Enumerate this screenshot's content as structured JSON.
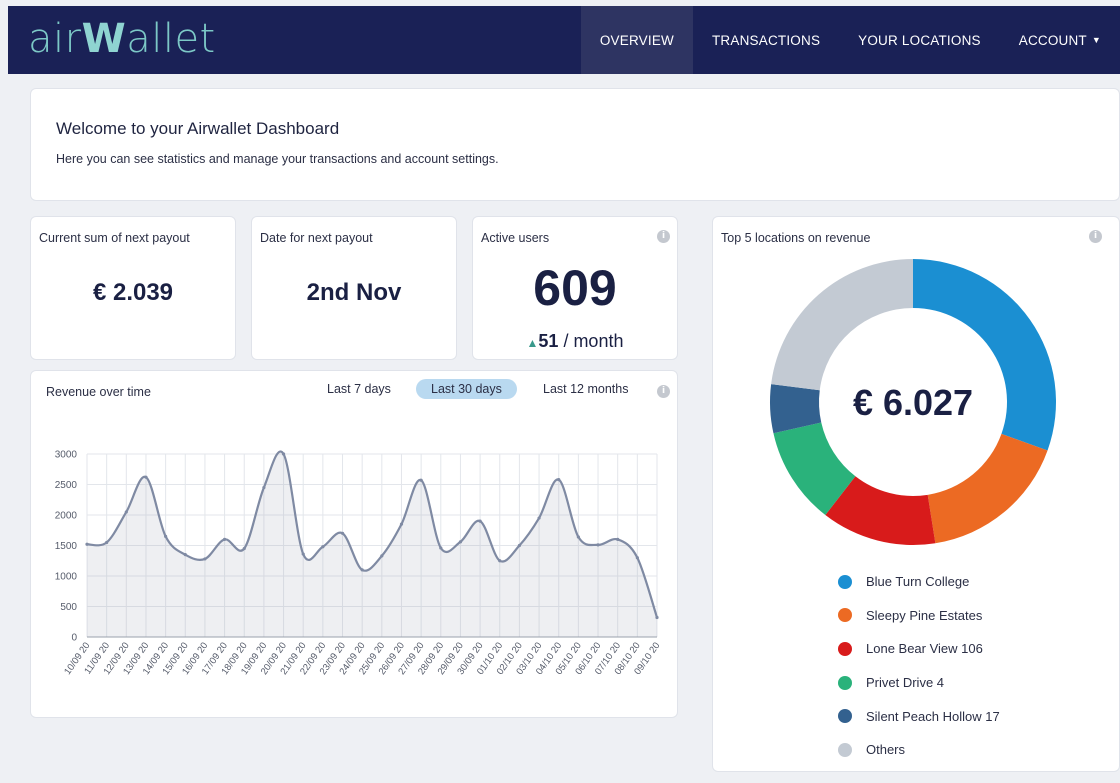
{
  "app": {
    "logo_light": "air",
    "logo_bold": "W",
    "logo_rest": "allet"
  },
  "nav": {
    "items": [
      {
        "label": "OVERVIEW"
      },
      {
        "label": "TRANSACTIONS"
      },
      {
        "label": "YOUR LOCATIONS"
      },
      {
        "label": "ACCOUNT"
      }
    ],
    "active": "OVERVIEW"
  },
  "welcome": {
    "title": "Welcome to your Airwallet Dashboard",
    "subtitle": "Here you can see statistics and manage your transactions and account settings."
  },
  "stats": {
    "payout_sum": {
      "label": "Current sum of next payout",
      "value": "€ 2.039"
    },
    "payout_date": {
      "label": "Date for next payout",
      "value": "2nd Nov"
    },
    "active_users": {
      "label": "Active users",
      "value": "609",
      "delta_value": "51",
      "delta_unit": " / month",
      "delta_arrow": "▲"
    }
  },
  "revenue": {
    "title": "Revenue over time",
    "ranges": [
      "Last 7 days",
      "Last 30 days",
      "Last 12 months"
    ],
    "selected_range": "Last 30 days"
  },
  "locations": {
    "title": "Top 5 locations on revenue",
    "total": "€ 6.027"
  },
  "icons": {
    "info": "info-icon",
    "caret": "caret-down-icon",
    "delta": "triangle-up-icon"
  },
  "colors": {
    "navbar": "#1a2156",
    "accent": "#7cc8c6",
    "selected_range": "#b9d9f0",
    "line": "#7f8aa3",
    "delta": "#3a9a8c"
  },
  "chart_data": [
    {
      "type": "line",
      "x": [
        "10/09 20",
        "11/09 20",
        "12/09 20",
        "13/09 20",
        "14/09 20",
        "15/09 20",
        "16/09 20",
        "17/09 20",
        "18/09 20",
        "19/09 20",
        "20/09 20",
        "21/09 20",
        "22/09 20",
        "23/09 20",
        "24/09 20",
        "25/09 20",
        "26/09 20",
        "27/09 20",
        "28/09 20",
        "29/09 20",
        "30/09 20",
        "01/10 20",
        "02/10 20",
        "03/10 20",
        "04/10 20",
        "05/10 20",
        "06/10 20",
        "07/10 20",
        "08/10 20",
        "09/10 20"
      ],
      "series": [
        {
          "values": [
            1520,
            1550,
            2050,
            2620,
            1650,
            1350,
            1280,
            1600,
            1450,
            2450,
            3000,
            1360,
            1480,
            1700,
            1100,
            1330,
            1850,
            2570,
            1460,
            1560,
            1900,
            1250,
            1500,
            1950,
            2580,
            1640,
            1510,
            1600,
            1300,
            320
          ]
        }
      ],
      "ylim": [
        0,
        3000
      ],
      "yticks": [
        0,
        500,
        1000,
        1500,
        2000,
        2500,
        3000
      ],
      "grid": true
    },
    {
      "type": "pie",
      "labels": [
        "Blue Turn College",
        "Sleepy Pine Estates",
        "Lone Bear View 106",
        "Privet Drive 4",
        "Silent Peach Hollow 17",
        "Others"
      ],
      "values": [
        30.5,
        17,
        13,
        11,
        5.5,
        23
      ],
      "colors": [
        "#1b8fd2",
        "#ec6a23",
        "#d81b1b",
        "#2ab27b",
        "#33618f",
        "#c3cad3"
      ],
      "center_label": "€ 6.027",
      "legend": "bottom"
    }
  ]
}
